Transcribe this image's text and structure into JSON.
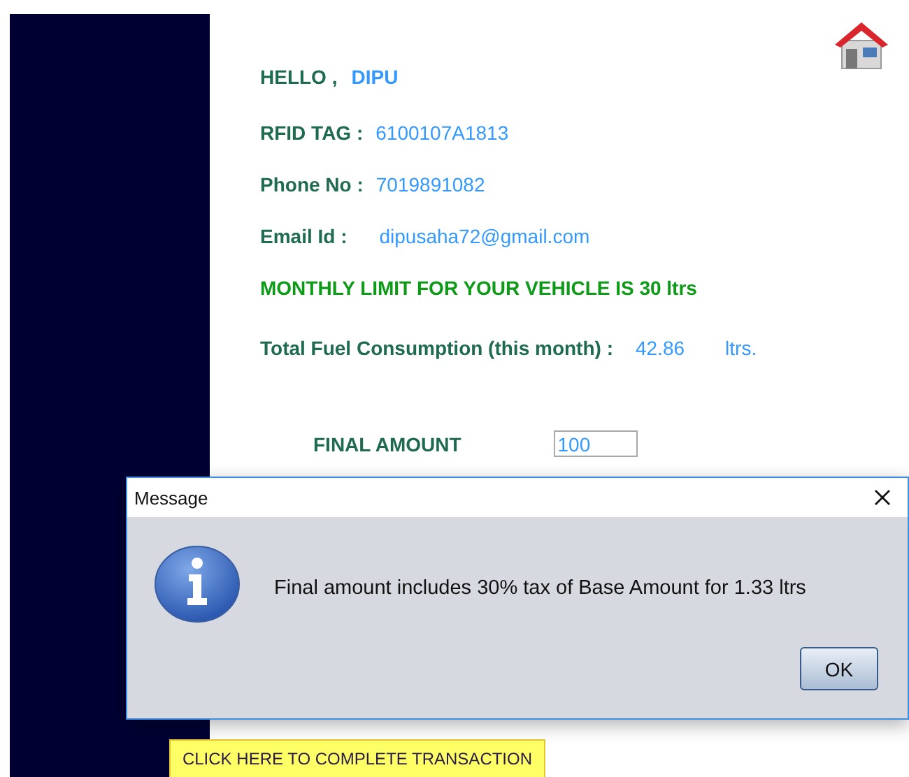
{
  "greeting": {
    "label": "HELLO ,",
    "name": "DIPU"
  },
  "details": [
    {
      "label": "RFID TAG :",
      "value": "6100107A1813"
    },
    {
      "label": "Phone No :",
      "value": "7019891082"
    },
    {
      "label": "Email Id :",
      "value": "dipusaha72@gmail.com"
    }
  ],
  "limit_notice": "MONTHLY LIMIT FOR YOUR VEHICLE IS 30 ltrs",
  "consumption": {
    "label": "Total Fuel Consumption (this month) :",
    "value": "42.86",
    "unit": "ltrs."
  },
  "final_amount": {
    "label": "FINAL AMOUNT",
    "value": "100"
  },
  "dialog": {
    "title": "Message",
    "message": "Final amount includes 30% tax of Base Amount for 1.33 ltrs",
    "button": "OK"
  },
  "action_button": "CLICK HERE TO COMPLETE TRANSACTION"
}
